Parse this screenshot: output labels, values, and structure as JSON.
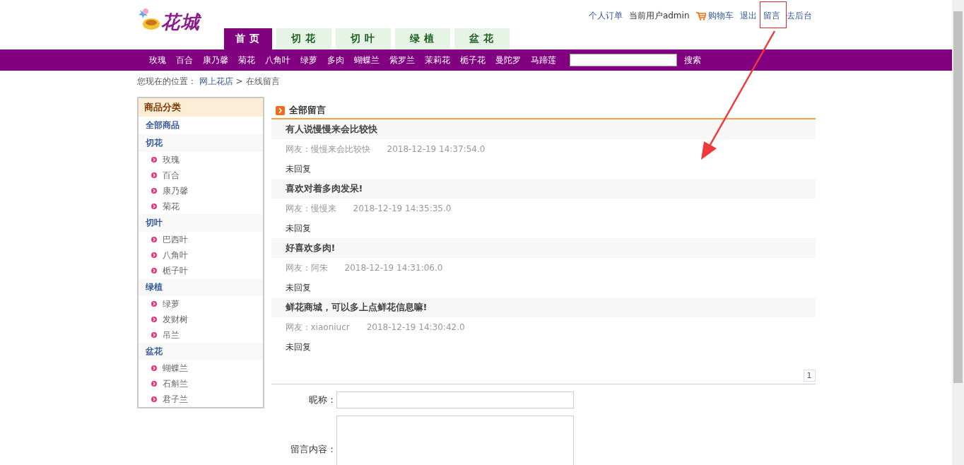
{
  "header": {
    "logo_text": "花城",
    "main_tabs": [
      {
        "label": "首 页",
        "selected": true
      },
      {
        "label": "切 花",
        "selected": false
      },
      {
        "label": "切 叶",
        "selected": false
      },
      {
        "label": "绿 植",
        "selected": false
      },
      {
        "label": "盆 花",
        "selected": false
      }
    ],
    "user_links": [
      {
        "kind": "link",
        "text": "个人订单"
      },
      {
        "kind": "text",
        "text": "当前用户admin"
      },
      {
        "kind": "cart",
        "text": "购物车"
      },
      {
        "kind": "link",
        "text": "退出"
      },
      {
        "kind": "link",
        "text": "留言"
      },
      {
        "kind": "link",
        "text": "去后台"
      }
    ]
  },
  "category_nav": {
    "items": [
      "玫瑰",
      "百合",
      "康乃馨",
      "菊花",
      "八角叶",
      "绿萝",
      "多肉",
      "蝴蝶兰",
      "紫罗兰",
      "茉莉花",
      "栀子花",
      "曼陀罗",
      "马蹄莲"
    ],
    "search_button": "搜索"
  },
  "breadcrumb": {
    "prefix": "您现在的位置：",
    "link": "网上花店",
    "separator": ">",
    "current": "在线留言"
  },
  "sidebar": {
    "title": "商品分类",
    "all": "全部商品",
    "groups": [
      {
        "name": "切花",
        "children": [
          "玫瑰",
          "百合",
          "康乃馨",
          "菊花"
        ]
      },
      {
        "name": "切叶",
        "children": [
          "巴西叶",
          "八角叶",
          "栀子叶"
        ]
      },
      {
        "name": "绿植",
        "children": [
          "绿萝",
          "发财树",
          "吊兰"
        ]
      },
      {
        "name": "盆花",
        "children": [
          "蝴蝶兰",
          "石斛兰",
          "君子兰"
        ]
      }
    ]
  },
  "messages": {
    "title": "全部留言",
    "items": [
      {
        "title": "有人说慢慢来会比较快",
        "author": "网友：慢慢来会比较快",
        "time": "2018-12-19 14:37:54.0",
        "reply": "未回复"
      },
      {
        "title": "喜欢对着多肉发呆!",
        "author": "网友：慢慢来",
        "time": "2018-12-19 14:35:35.0",
        "reply": "未回复"
      },
      {
        "title": "好喜欢多肉!",
        "author": "网友：阿朱",
        "time": "2018-12-19 14:31:06.0",
        "reply": "未回复"
      },
      {
        "title": "鲜花商城，可以多上点鲜花信息嘛!",
        "author": "网友：xiaoniucr",
        "time": "2018-12-19 14:30:42.0",
        "reply": "未回复"
      }
    ],
    "pages": [
      "1"
    ]
  },
  "form": {
    "fields": [
      {
        "kind": "input",
        "label": "昵称："
      },
      {
        "kind": "textarea",
        "label": "留言内容："
      }
    ]
  }
}
